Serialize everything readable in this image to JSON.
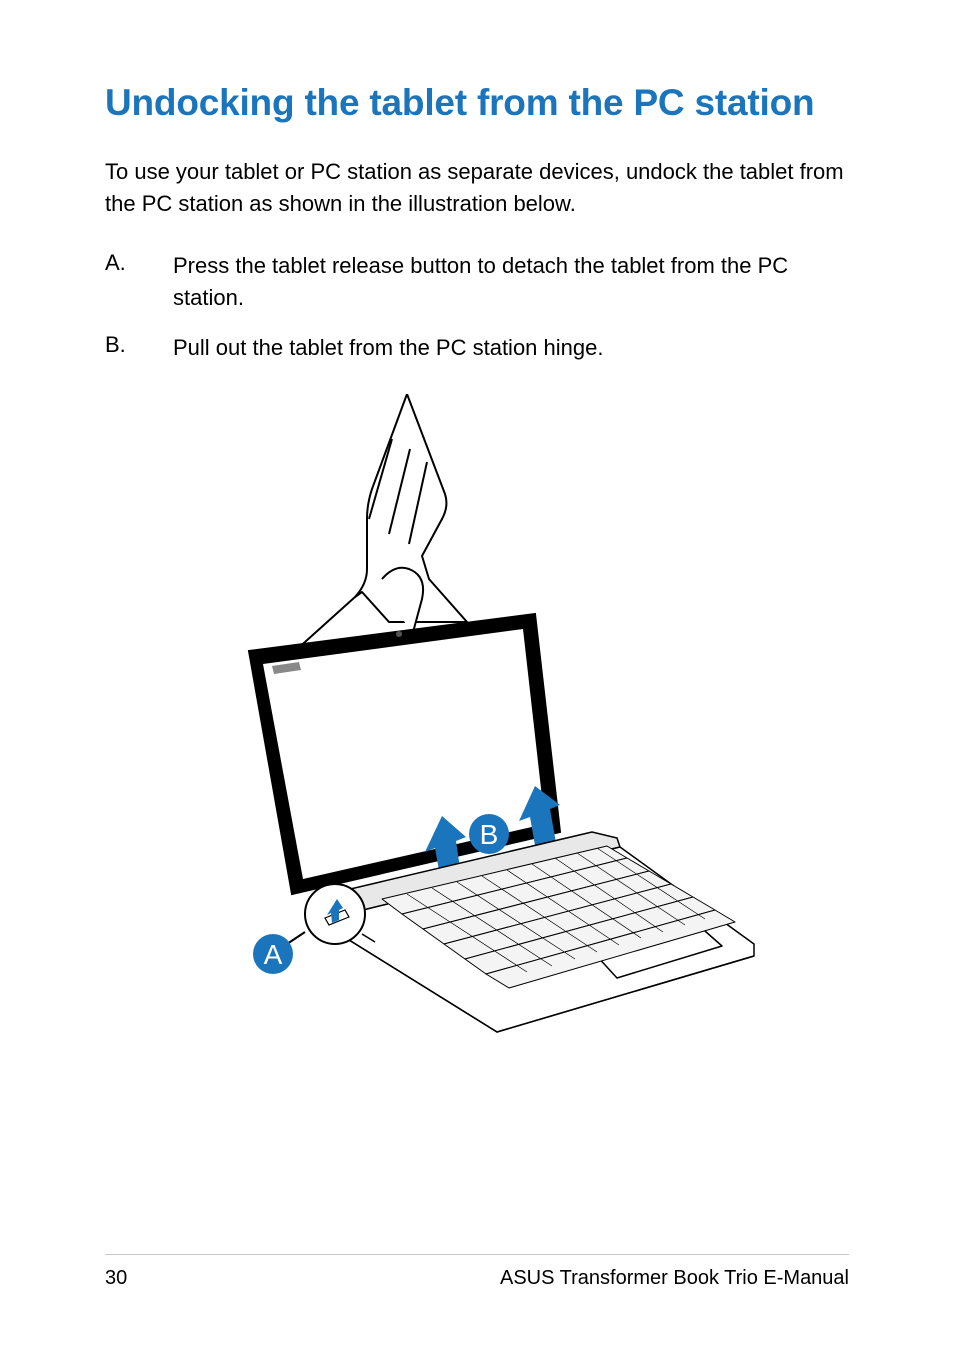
{
  "heading": "Undocking the tablet from the PC station",
  "intro": "To use your tablet or PC station as separate devices, undock the tablet from the PC station as shown in the illustration below.",
  "steps": [
    {
      "label": "A.",
      "text": "Press the tablet release button to detach the tablet from the PC station."
    },
    {
      "label": "B.",
      "text": "Pull out the tablet from the PC station hinge."
    }
  ],
  "callouts": {
    "a": "A",
    "b": "B"
  },
  "footer": {
    "page": "30",
    "title": "ASUS Transformer Book Trio E-Manual"
  },
  "colors": {
    "accent": "#1b75bc"
  }
}
